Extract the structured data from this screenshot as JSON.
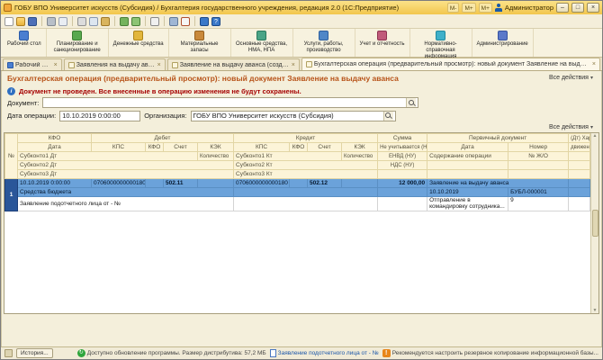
{
  "window": {
    "title": "ГОБУ ВПО Университет искусств (Субсидия) / Бухгалтерия государственного учреждения, редакция 2.0 (1С:Предприятие)",
    "mem_buttons": [
      "М-",
      "М+",
      "М+"
    ],
    "user": "Администратор",
    "controls": {
      "minimize": "–",
      "maximize": "□",
      "close": "×"
    }
  },
  "icons": {
    "chevron": "▾",
    "close": "×",
    "info": "i",
    "help": "?",
    "update": "↻",
    "warn": "!"
  },
  "ribbon": {
    "items": [
      {
        "label": "Рабочий стол"
      },
      {
        "label": "Планирование и санкционирование"
      },
      {
        "label": "Денежные средства"
      },
      {
        "label": "Материальные запасы"
      },
      {
        "label": "Основные средства, НМА, НПА"
      },
      {
        "label": "Услуги, работы, производство"
      },
      {
        "label": "Учет и отчетность"
      },
      {
        "label": "Нормативно-справочная информация"
      },
      {
        "label": "Администрирование"
      }
    ]
  },
  "tabs": {
    "items": [
      {
        "label": "Рабочий стол"
      },
      {
        "label": "Заявления на выдачу аванса"
      },
      {
        "label": "Заявление на выдачу аванса (создание)"
      },
      {
        "label": "Бухгалтерская операция (предварительный просмотр): новый документ Заявление на выдачу аванса"
      }
    ]
  },
  "page": {
    "title": "Бухгалтерская операция (предварительный просмотр): новый документ Заявление на выдачу аванса",
    "all_actions": "Все действия",
    "warning": "Документ не проведен. Все внесенные в операцию изменения не будут сохранены.",
    "fields": {
      "document_label": "Документ:",
      "document_value": "",
      "date_label": "Дата операции:",
      "date_value": "10.10.2019 0:00:00",
      "org_label": "Организация:",
      "org_value": "ГОБУ ВПО Университет искусств (Субсидия)"
    }
  },
  "table": {
    "h": {
      "num": "№",
      "kfo": "КФО",
      "debit": "Дебет",
      "credit": "Кредит",
      "summa": "Сумма",
      "primary_doc": "Первичный документ",
      "dt_char": "(Дт) Характеристика",
      "date": "Дата",
      "kps": "КПС",
      "schet": "Счет",
      "kek": "КЭК",
      "not_counted": "Не учитывается (НУ)",
      "nomer": "Номер",
      "dvizheniy": "движений",
      "sub1dt": "Субконто1 Дт",
      "sub2dt": "Субконто2 Дт",
      "sub3dt": "Субконто3 Дт",
      "sub1kt": "Субконто1 Кт",
      "sub2kt": "Субконто2 Кт",
      "sub3kt": "Субконто3 Кт",
      "qty": "Количество",
      "envd": "ЕНВД (НУ)",
      "nds": "НДС (НУ)",
      "soderzhanie": "Содержание операции",
      "jo": "№ Ж/О"
    },
    "row": {
      "num": "1",
      "date": "10.10.2019 0:00:00",
      "debit_kps": "0706000000000180",
      "debit_schet": "502.11",
      "credit_kps": "0706000000000180",
      "credit_schet": "502.12",
      "summa": "12 000,00",
      "doc_type": "Заявление на выдачу аванса",
      "sub1dt": "Средства бюджета",
      "sub2dt": "Заявление подотчетного лица от - №",
      "doc_date": "10.10.2019",
      "doc_num": "БУБЛ-000001",
      "operation": "Отправление в командировку сотрудника...",
      "jo": "9"
    }
  },
  "statusbar": {
    "history": "История...",
    "update_text": "Доступно обновление программы. Размер дистрибутива: 57,2 МБ",
    "doc_link": "Заявление подотчетного лица от - №",
    "backup_text": "Рекомендуется настроить резервное копирование информационной базы..."
  }
}
